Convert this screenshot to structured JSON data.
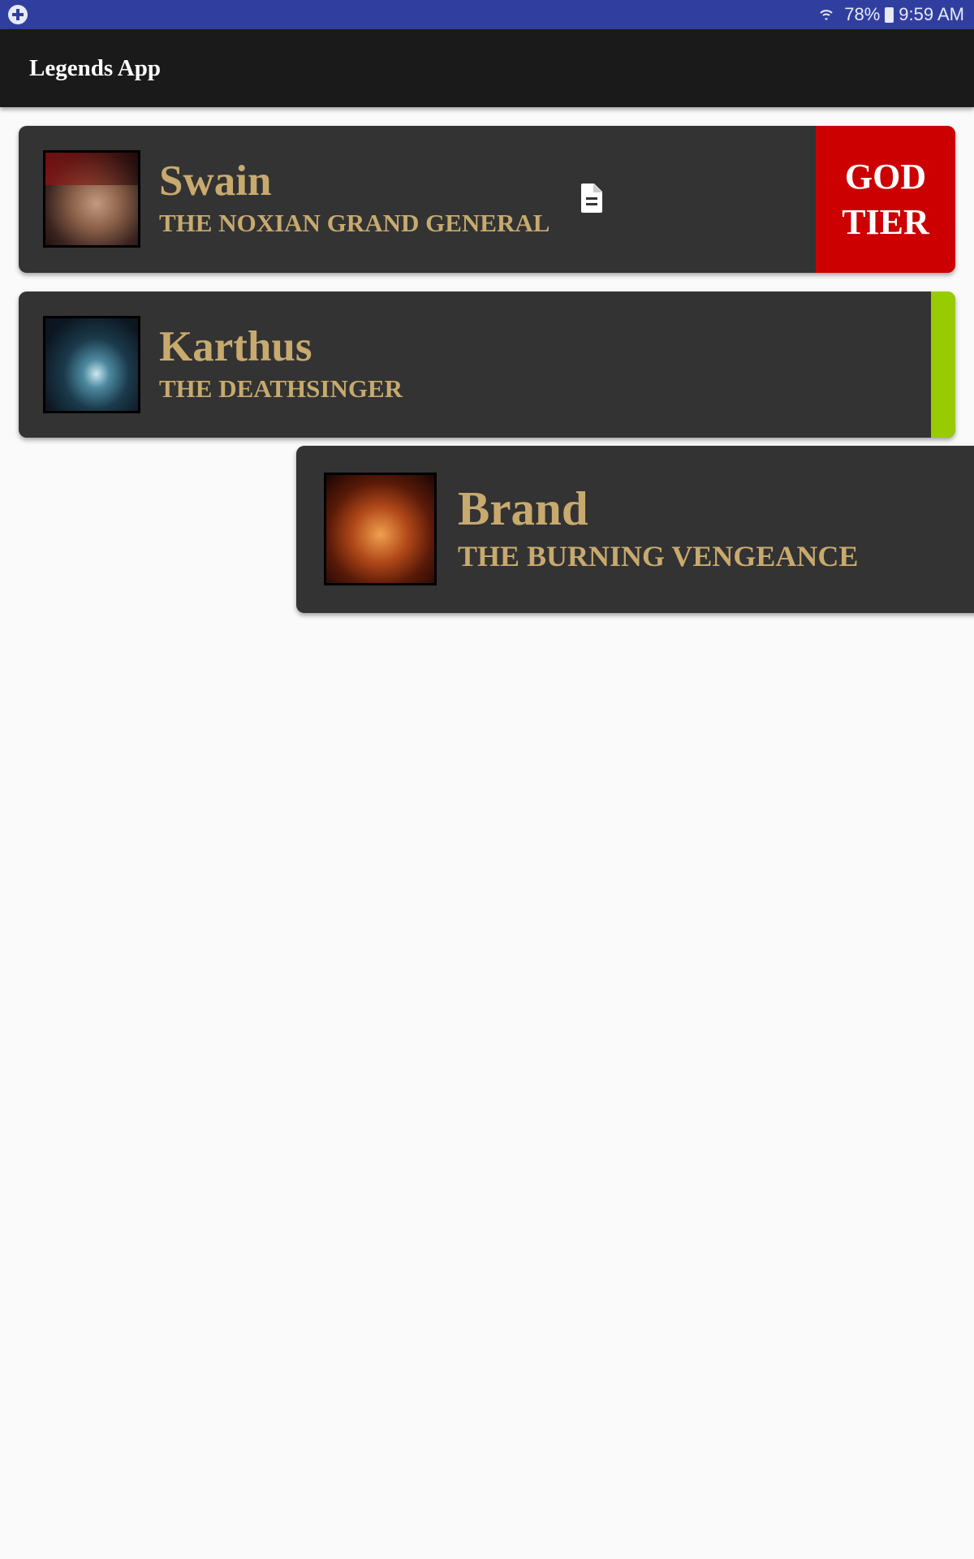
{
  "status_bar": {
    "battery": "78%",
    "time": "9:59 AM"
  },
  "app_bar": {
    "title": "Legends App"
  },
  "champions": [
    {
      "name": "Swain",
      "title": "THE NOXIAN GRAND GENERAL",
      "tier_line1": "GOD",
      "tier_line2": "TIER",
      "tier_color": "#cc0000",
      "has_notes_icon": true
    },
    {
      "name": "Karthus",
      "title": "THE DEATHSINGER",
      "tier_color": "#99cc00"
    },
    {
      "name": "Brand",
      "title": "THE BURNING VENGEANCE"
    }
  ],
  "colors": {
    "status_bar": "#303f9f",
    "app_bar": "#1a1a1a",
    "card": "#333333",
    "gold_text": "#c8aa6e",
    "background": "#fafafa"
  }
}
